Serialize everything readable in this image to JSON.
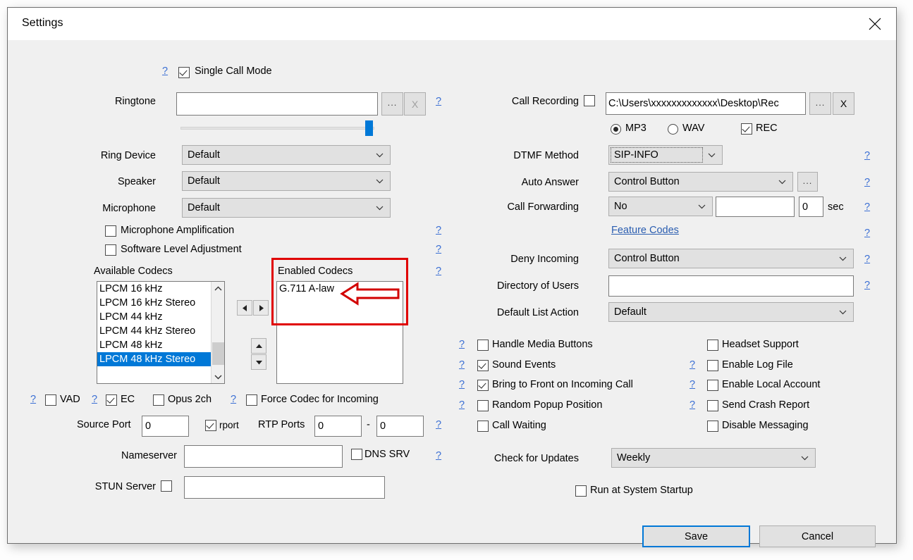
{
  "window": {
    "title": "Settings",
    "close_icon": "close-icon"
  },
  "left": {
    "single_call_mode": {
      "label": "Single Call Mode",
      "checked": true,
      "help": "?"
    },
    "ringtone": {
      "label": "Ringtone",
      "value": "",
      "browse_label": "...",
      "clear_label": "X",
      "help": "?"
    },
    "volume": {
      "value_pct": 96
    },
    "ring_device": {
      "label": "Ring Device",
      "value": "Default"
    },
    "speaker": {
      "label": "Speaker",
      "value": "Default"
    },
    "microphone": {
      "label": "Microphone",
      "value": "Default"
    },
    "mic_amplification": {
      "label": "Microphone Amplification",
      "checked": false,
      "help": "?"
    },
    "software_level_adjustment": {
      "label": "Software Level Adjustment",
      "checked": false,
      "help": "?"
    },
    "available_codecs": {
      "label": "Available Codecs",
      "items": [
        {
          "text": "LPCM 16 kHz",
          "selected": false
        },
        {
          "text": "LPCM 16 kHz Stereo",
          "selected": false
        },
        {
          "text": "LPCM 44 kHz",
          "selected": false
        },
        {
          "text": "LPCM 44 kHz Stereo",
          "selected": false
        },
        {
          "text": "LPCM 48 kHz",
          "selected": false
        },
        {
          "text": "LPCM 48 kHz Stereo",
          "selected": true
        }
      ]
    },
    "enabled_codecs": {
      "label": "Enabled Codecs",
      "items": [
        {
          "text": "G.711 A-law",
          "selected": false
        }
      ],
      "help": "?"
    },
    "transfer_buttons": {
      "move_left": "◄",
      "move_right": "►",
      "move_up": "▲",
      "move_down": "▼"
    },
    "vad": {
      "label": "VAD",
      "checked": false,
      "help": "?"
    },
    "ec": {
      "label": "EC",
      "checked": true,
      "help": "?"
    },
    "opus_2ch": {
      "label": "Opus 2ch",
      "checked": false
    },
    "force_codec": {
      "label": "Force Codec for Incoming",
      "checked": false,
      "help": "?"
    },
    "source_port": {
      "label": "Source Port",
      "value": "0"
    },
    "rport": {
      "label": "rport",
      "checked": true
    },
    "rtp_ports": {
      "label": "RTP Ports",
      "from": "0",
      "to": "0",
      "separator": "-",
      "help": "?"
    },
    "nameserver": {
      "label": "Nameserver",
      "value": "",
      "help": "?"
    },
    "dns_srv": {
      "label": "DNS SRV",
      "checked": false
    },
    "stun_server": {
      "label": "STUN Server",
      "checked": false,
      "value": ""
    }
  },
  "right": {
    "call_recording": {
      "label": "Call Recording",
      "checked": false,
      "path": "C:\\Users\\xxxxxxxxxxxxx\\Desktop\\Rec",
      "browse_label": "...",
      "clear_label": "X"
    },
    "format_mp3": {
      "label": "MP3",
      "selected": true
    },
    "format_wav": {
      "label": "WAV",
      "selected": false
    },
    "rec": {
      "label": "REC",
      "checked": true
    },
    "dtmf_method": {
      "label": "DTMF Method",
      "value": "SIP-INFO",
      "help": "?"
    },
    "auto_answer": {
      "label": "Auto Answer",
      "value": "Control Button",
      "browse_label": "...",
      "help": "?"
    },
    "call_forwarding": {
      "label": "Call Forwarding",
      "value": "No",
      "target": "",
      "seconds": "0",
      "unit": "sec",
      "help": "?"
    },
    "feature_codes": {
      "label": "Feature Codes",
      "help": "?"
    },
    "deny_incoming": {
      "label": "Deny Incoming",
      "value": "Control Button",
      "help": "?"
    },
    "directory_of_users": {
      "label": "Directory of Users",
      "value": "",
      "help": "?"
    },
    "default_list_action": {
      "label": "Default List Action",
      "value": "Default"
    },
    "options_left": [
      {
        "label": "Handle Media Buttons",
        "checked": false,
        "help": "?"
      },
      {
        "label": "Sound Events",
        "checked": true,
        "help": "?"
      },
      {
        "label": "Bring to Front on Incoming Call",
        "checked": true,
        "help": "?"
      },
      {
        "label": "Random Popup Position",
        "checked": false,
        "help": "?"
      },
      {
        "label": "Call Waiting",
        "checked": false,
        "help": ""
      }
    ],
    "options_right": [
      {
        "label": "Headset Support",
        "checked": false,
        "help": ""
      },
      {
        "label": "Enable Log File",
        "checked": false,
        "help": "?"
      },
      {
        "label": "Enable Local Account",
        "checked": false,
        "help": "?"
      },
      {
        "label": "Send Crash Report",
        "checked": false,
        "help": "?"
      },
      {
        "label": "Disable Messaging",
        "checked": false,
        "help": ""
      }
    ],
    "check_for_updates": {
      "label": "Check for Updates",
      "value": "Weekly"
    },
    "run_at_startup": {
      "label": "Run at System Startup",
      "checked": false
    }
  },
  "footer": {
    "save_label": "Save",
    "cancel_label": "Cancel"
  },
  "annotation": {
    "highlight_color": "#e00000",
    "arrow_target": "G.711 A-law"
  }
}
